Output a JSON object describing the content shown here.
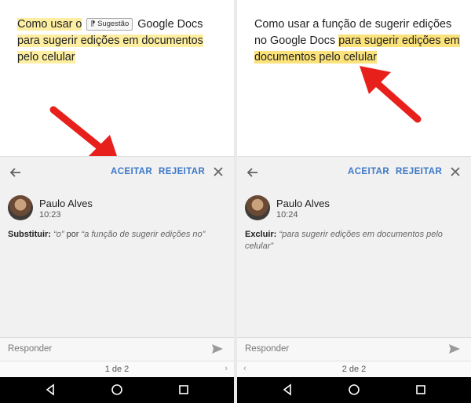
{
  "left": {
    "doc": {
      "text_before": "Como usar o",
      "chip": "Sugestão",
      "text_after": " Google Docs ",
      "highlight": "para sugerir edições em documentos pelo celular"
    },
    "toolbar": {
      "accept": "ACEITAR",
      "reject": "REJEITAR"
    },
    "comment": {
      "author": "Paulo Alves",
      "time": "10:23",
      "action": "Substituir:",
      "old": "“o”",
      "por": " por ",
      "new": "“a função de sugerir edições no”"
    },
    "reply_placeholder": "Responder",
    "pager": "1 de 2"
  },
  "right": {
    "doc": {
      "text_before": "Como usar a função de sugerir edições no Google Docs",
      "highlight": "para sugerir edições em documentos pelo celular"
    },
    "toolbar": {
      "accept": "ACEITAR",
      "reject": "REJEITAR"
    },
    "comment": {
      "author": "Paulo Alves",
      "time": "10:24",
      "action": "Excluir:",
      "deleted": "“para sugerir edições em documentos pelo celular”"
    },
    "reply_placeholder": "Responder",
    "pager": "2 de 2"
  },
  "icons": [
    "arrow-back-icon",
    "close-icon",
    "send-icon",
    "nav-back-icon",
    "nav-home-icon",
    "nav-recents-icon",
    "chevron-right-icon",
    "chevron-left-icon",
    "red-pointer-arrow"
  ],
  "colors": {
    "accent": "#3c78c8",
    "highlight": "#fdeea2",
    "pointer": "#e8201c"
  }
}
